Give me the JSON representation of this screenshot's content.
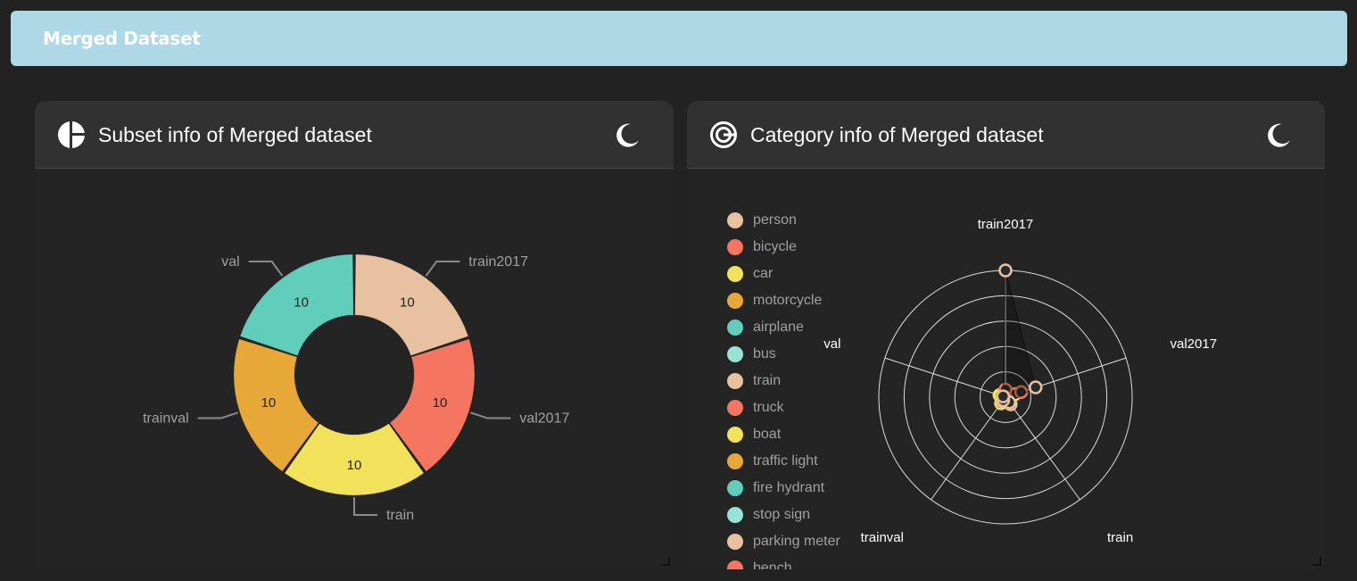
{
  "app": {
    "title": "Merged Dataset"
  },
  "colors": {
    "topbar": "#add8e6",
    "palette": [
      "#e8c1a0",
      "#f47560",
      "#f1e15b",
      "#e8a838",
      "#61cdbb",
      "#97e3d5"
    ]
  },
  "subset_panel": {
    "title": "Subset info of Merged dataset",
    "icon": "pie-chart-icon",
    "theme_toggle_icon": "moon-icon",
    "chart_data": {
      "type": "pie",
      "categories": [
        "train2017",
        "val2017",
        "train",
        "trainval",
        "val"
      ],
      "values": [
        10,
        10,
        10,
        10,
        10
      ],
      "legend_position": "bottom"
    },
    "legend": [
      "train2017",
      "val2017",
      "train",
      "trainval",
      "val"
    ]
  },
  "category_panel": {
    "title": "Category info of Merged dataset",
    "icon": "radar-chart-icon",
    "theme_toggle_icon": "moon-icon",
    "legend": [
      "person",
      "bicycle",
      "car",
      "motorcycle",
      "airplane",
      "bus",
      "train",
      "truck",
      "boat",
      "traffic light",
      "fire hydrant",
      "stop sign",
      "parking meter",
      "bench"
    ],
    "chart_data": {
      "type": "radar",
      "axes": [
        "train2017",
        "val2017",
        "train",
        "trainval",
        "val"
      ],
      "max": 10,
      "grid_levels": 5,
      "series": [
        {
          "name": "person",
          "values": [
            10,
            2.5,
            0.5,
            0.3,
            0.2
          ]
        },
        {
          "name": "bicycle",
          "values": [
            0.6,
            1.3,
            0.2,
            0.2,
            0.1
          ]
        },
        {
          "name": "car",
          "values": [
            0.3,
            0.8,
            0.3,
            0.3,
            0.4
          ]
        },
        {
          "name": "motorcycle",
          "values": [
            0.2,
            0.3,
            0.2,
            0.3,
            0.3
          ]
        },
        {
          "name": "airplane",
          "values": [
            0.2,
            0.4,
            0.3,
            0.2,
            0.2
          ]
        },
        {
          "name": "bus",
          "values": [
            0.2,
            0.3,
            0.2,
            0.3,
            0.3
          ]
        },
        {
          "name": "train",
          "values": [
            0.3,
            0.2,
            0.7,
            0.4,
            0.2
          ]
        },
        {
          "name": "truck",
          "values": [
            0.2,
            0.2,
            0.3,
            0.2,
            0.2
          ]
        },
        {
          "name": "boat",
          "values": [
            0.2,
            0.2,
            0.3,
            0.6,
            0.5
          ]
        },
        {
          "name": "traffic light",
          "values": [
            0.1,
            0.1,
            0.2,
            0.2,
            0.2
          ]
        },
        {
          "name": "fire hydrant",
          "values": [
            0.1,
            0.1,
            0.1,
            0.1,
            0.1
          ]
        },
        {
          "name": "stop sign",
          "values": [
            0.1,
            0.1,
            0.1,
            0.1,
            0.1
          ]
        },
        {
          "name": "parking meter",
          "values": [
            0.1,
            0.1,
            0.1,
            0.1,
            0.1
          ]
        },
        {
          "name": "bench",
          "values": [
            0.1,
            0.1,
            0.1,
            0.1,
            0.1
          ]
        }
      ]
    }
  }
}
